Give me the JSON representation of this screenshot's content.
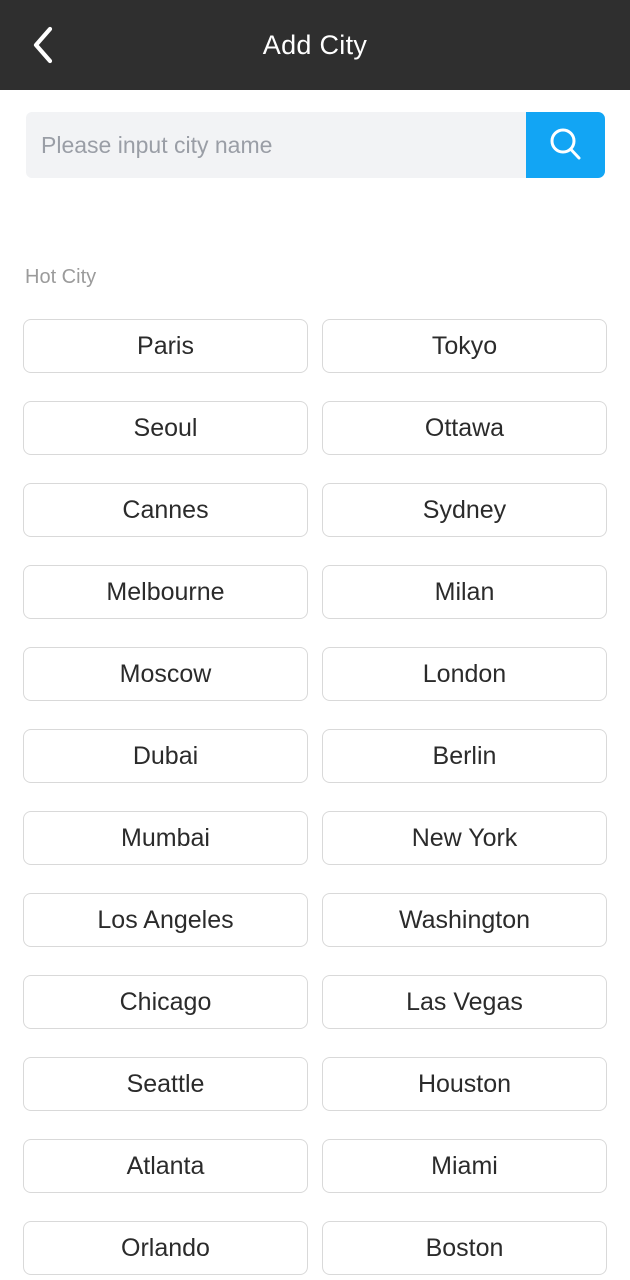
{
  "header": {
    "title": "Add City",
    "back_icon": "chevron-left-icon",
    "background_color": "#2f2f2f",
    "title_color": "#ffffff"
  },
  "search": {
    "placeholder": "Please input city name",
    "value": "",
    "button_icon": "search-icon",
    "button_color": "#12a5f4",
    "field_background": "#f2f3f5"
  },
  "hot_city": {
    "label": "Hot City",
    "label_color": "#9b9b9b",
    "cities": [
      "Paris",
      "Tokyo",
      "Seoul",
      "Ottawa",
      "Cannes",
      "Sydney",
      "Melbourne",
      "Milan",
      "Moscow",
      "London",
      "Dubai",
      "Berlin",
      "Mumbai",
      "New York",
      "Los Angeles",
      "Washington",
      "Chicago",
      "Las Vegas",
      "Seattle",
      "Houston",
      "Atlanta",
      "Miami",
      "Orlando",
      "Boston"
    ]
  }
}
